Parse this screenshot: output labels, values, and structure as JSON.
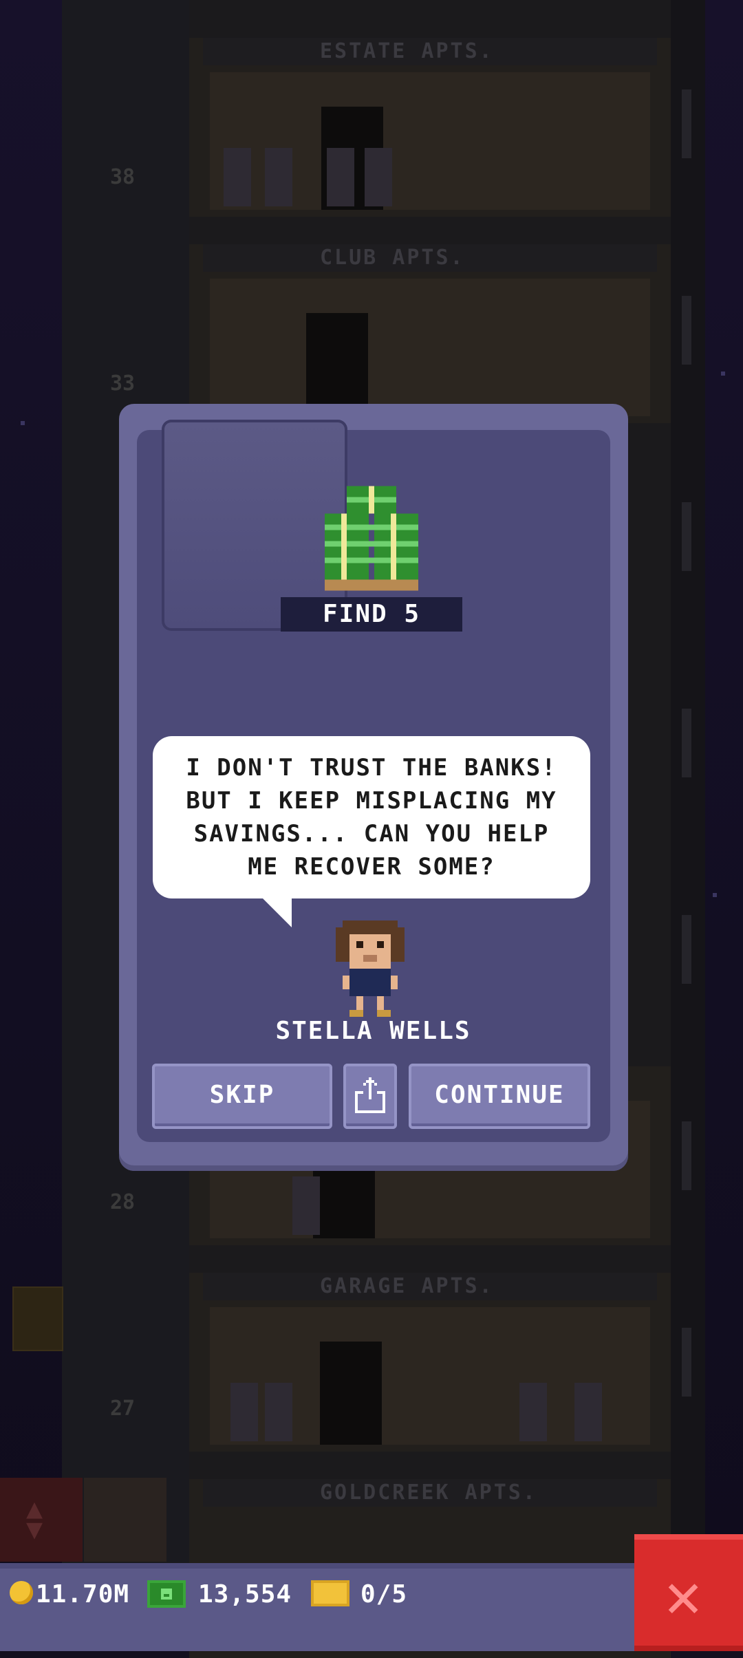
{
  "background": {
    "floor_labels": [
      "ESTATE APTS.",
      "CLUB APTS.",
      "GARAGE APTS.",
      "GOLDCREEK APTS."
    ],
    "floor_numbers": [
      "38",
      "33",
      "28",
      "27"
    ]
  },
  "mission": {
    "icon": "cash-stack-icon",
    "caption": "FIND 5",
    "dialogue": "I DON'T TRUST THE BANKS!\nBUT I KEEP MISPLACING MY\nSAVINGS... CAN YOU HELP\nME RECOVER SOME?",
    "npc_name": "STELLA WELLS"
  },
  "buttons": {
    "skip": "SKIP",
    "share_icon": "share-icon",
    "continue": "CONTINUE"
  },
  "hud": {
    "coins": "11.70M",
    "bux": "13,554",
    "tickets": "0/5",
    "close_icon": "close-icon"
  },
  "colors": {
    "modal": "#6a6898",
    "modal_inner": "#4c4a78",
    "close_button": "#d92c2c",
    "coin": "#f3c234",
    "cash": "#3aa53a"
  }
}
